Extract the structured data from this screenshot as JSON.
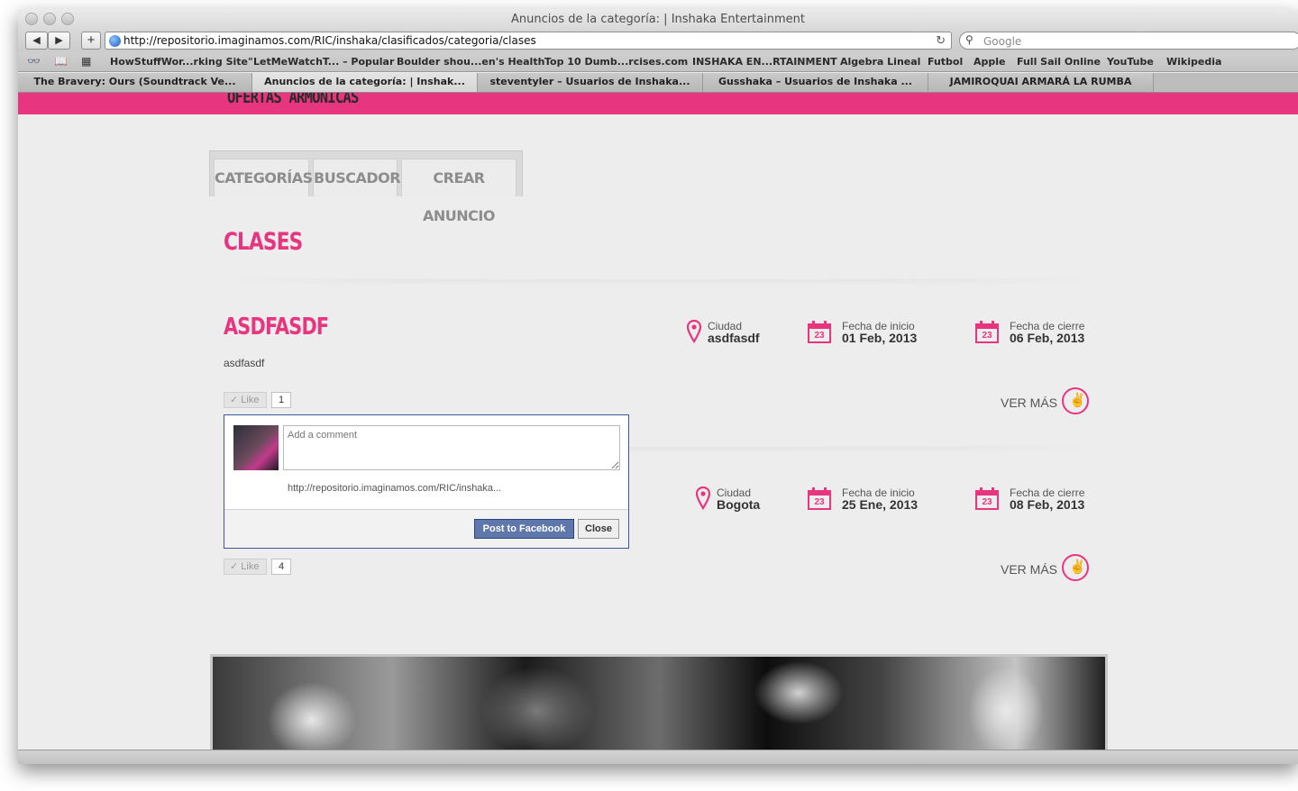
{
  "window": {
    "title": "Anuncios de la categoría: | Inshaka Entertainment"
  },
  "toolbar": {
    "back_label": "◀",
    "forward_label": "▶",
    "add_label": "+",
    "url": "http://repositorio.imaginamos.com/RIC/inshaka/clasificados/categoria/clases",
    "reload_label": "↻",
    "search_placeholder": "Google"
  },
  "bookmarks": [
    "HowStuffWor...rking Site\"",
    "LetMeWatchT... – Popular",
    "Boulder shou...en's Health",
    "Top 10 Dumb...rcises.com",
    "INSHAKA EN...RTAINMENT",
    "Algebra Lineal",
    "Futbol",
    "Apple",
    "Full Sail Online",
    "YouTube",
    "Wikipedia"
  ],
  "tabs": [
    "The Bravery: Ours (Soundtrack Ve...",
    "Anuncios de la categoría: | Inshak...",
    "steventyler – Usuarios de Inshaka...",
    "Gusshaka – Usuarios de Inshaka ...",
    "JAMIROQUAI ARMARÁ LA RUMBA"
  ],
  "page": {
    "section_title": "OFERTAS ARMÓNICAS",
    "nav_tabs": [
      "CATEGORÍAS",
      "BUSCADOR",
      "CREAR ANUNCIO"
    ],
    "category_title": "CLASES",
    "listings": [
      {
        "title": "ASDFASDF",
        "description": "asdfasdf",
        "city_label": "Ciudad",
        "city": "asdfasdf",
        "start_label": "Fecha de inicio",
        "start_date": "01 Feb, 2013",
        "end_label": "Fecha de cierre",
        "end_date": "06 Feb, 2013",
        "calendar_day": "23",
        "like_label": "Like",
        "like_count": "1",
        "more_label": "VER MÁS"
      },
      {
        "title": "",
        "description": "",
        "city_label": "Ciudad",
        "city": "Bogota",
        "start_label": "Fecha de inicio",
        "start_date": "25 Ene, 2013",
        "end_label": "Fecha de cierre",
        "end_date": "08 Feb, 2013",
        "calendar_day": "23",
        "like_label": "Like",
        "like_count": "4",
        "more_label": "VER MÁS"
      }
    ],
    "comment_popup": {
      "placeholder": "Add a comment",
      "url": "http://repositorio.imaginamos.com/RIC/inshaka...",
      "post_label": "Post to Facebook",
      "close_label": "Close"
    }
  },
  "colors": {
    "accent": "#e8357f",
    "facebook": "#5f78ab"
  }
}
